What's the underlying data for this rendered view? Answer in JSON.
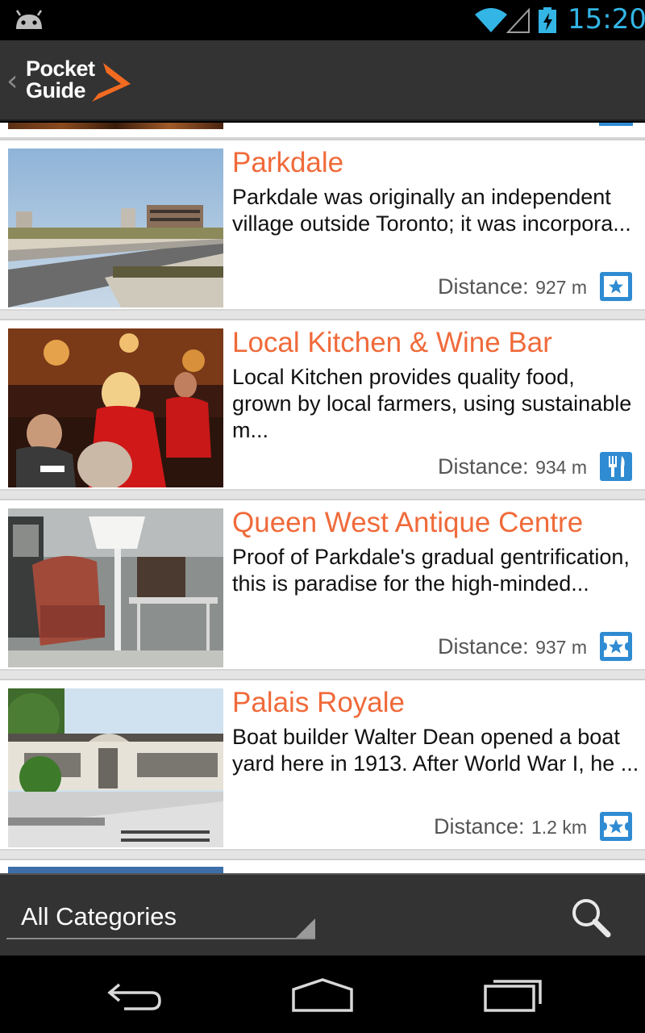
{
  "status_bar": {
    "time": "15:20",
    "icons": [
      "android-debug-icon",
      "wifi-icon",
      "signal-icon",
      "battery-charging-icon"
    ],
    "accent_color": "#33b5e5"
  },
  "action_bar": {
    "back_icon": "chevron-left-icon",
    "logo_line1": "Pocket",
    "logo_line2": "Guide",
    "logo_accent": "#f26b21"
  },
  "places": [
    {
      "title": "Parkdale",
      "description": "Parkdale was originally an independent village outside Toronto; it was incorpora...",
      "distance_label": "Distance:",
      "distance_value": "927 m",
      "category_icon": "sight-star-icon"
    },
    {
      "title": "Local Kitchen & Wine Bar",
      "description": "Local Kitchen provides quality food, grown by local farmers, using sustainable m...",
      "distance_label": "Distance:",
      "distance_value": "934 m",
      "category_icon": "restaurant-icon"
    },
    {
      "title": "Queen West Antique Centre",
      "description": "Proof of Parkdale's gradual gentrification, this is paradise for the high-minded...",
      "distance_label": "Distance:",
      "distance_value": "937 m",
      "category_icon": "sight-star-icon"
    },
    {
      "title": "Palais Royale",
      "description": "Boat builder Walter Dean opened a boat yard here in 1913. After World War I, he ...",
      "distance_label": "Distance:",
      "distance_value": "1.2 km",
      "category_icon": "sight-star-icon"
    }
  ],
  "bottom_bar": {
    "category_selected": "All Categories",
    "search_icon": "search-icon"
  },
  "nav_bar": {
    "icons": [
      "back-icon",
      "home-icon",
      "recent-apps-icon"
    ]
  },
  "colors": {
    "title_orange": "#f06a3a",
    "icon_blue": "#2f8bd2",
    "bar_gray": "#333333"
  }
}
